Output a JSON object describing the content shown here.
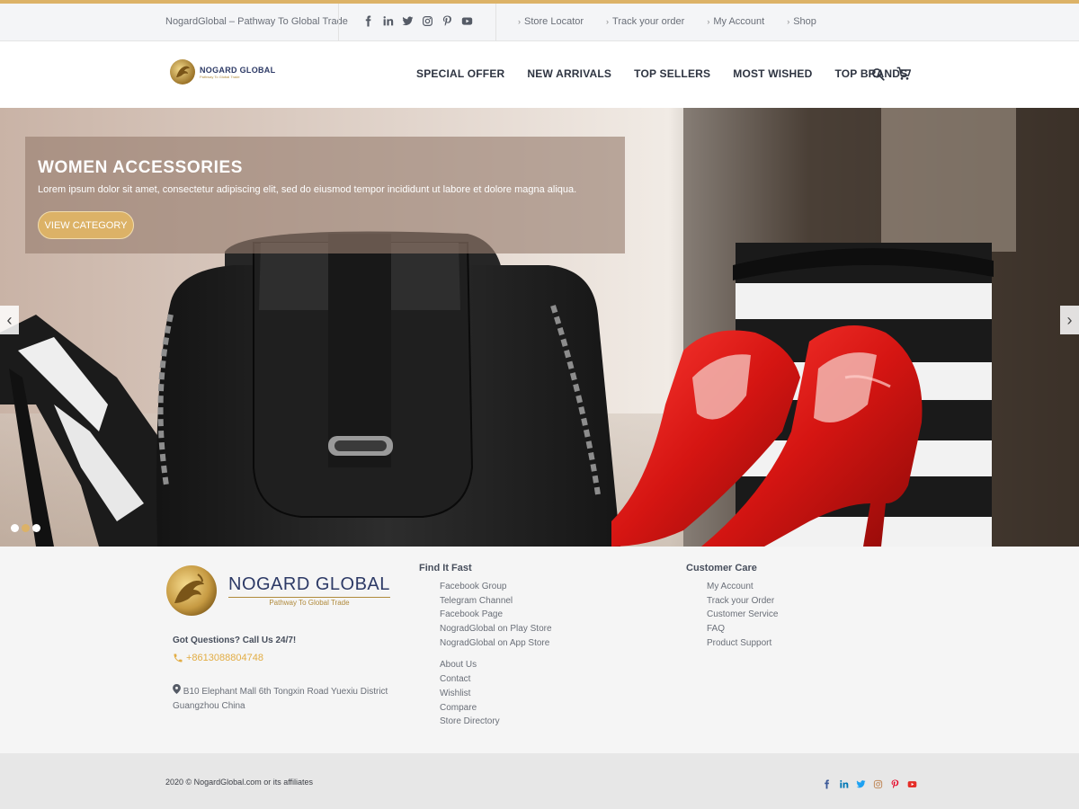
{
  "topbar": {
    "tagline": "NogardGlobal – Pathway To Global Trade",
    "links": [
      "Store Locator",
      "Track your order",
      "My Account",
      "Shop"
    ],
    "social_icons": [
      "facebook-icon",
      "linkedin-icon",
      "twitter-icon",
      "instagram-icon",
      "pinterest-icon",
      "youtube-icon"
    ]
  },
  "header": {
    "logo_text": "NOGARD GLOBAL",
    "logo_sub": "Pathway To Global Trade",
    "nav": [
      "SPECIAL OFFER",
      "NEW ARRIVALS",
      "TOP SELLERS",
      "MOST WISHED",
      "TOP BRANDS"
    ]
  },
  "hero": {
    "title": "WOMEN ACCESSORIES",
    "text": "Lorem ipsum dolor sit amet, consectetur adipiscing elit, sed do eiusmod tempor incididunt ut labore et dolore magna aliqua.",
    "button": "VIEW CATEGORY",
    "prev": "‹",
    "next": "›",
    "slide_count": 3,
    "active_slide": 2
  },
  "footer": {
    "logo_text": "NOGARD GLOBAL",
    "logo_sub": "Pathway To Global Trade",
    "questions": "Got Questions? Call Us 24/7!",
    "phone": "+8613088804748",
    "address": "B10 Elephant Mall 6th Tongxin Road Yuexiu District Guangzhou China",
    "find_title": "Find It Fast",
    "find_links": [
      "Facebook Group",
      "Telegram Channel",
      "Facebook Page",
      "NogradGlobal on Play Store",
      "NogradGlobal on App Store"
    ],
    "find_links_2": [
      "About Us",
      "Contact",
      "Wishlist",
      "Compare",
      "Store Directory"
    ],
    "care_title": "Customer Care",
    "care_links": [
      "My Account",
      "Track your Order",
      "Customer Service",
      "FAQ",
      "Product Support"
    ]
  },
  "bottom": {
    "copyright": "2020 © NogardGlobal.com or its affiliates"
  },
  "colors": {
    "accent": "#dcb267",
    "brand_navy": "#2d3a66",
    "facebook": "#3b5998",
    "linkedin": "#0077b5",
    "twitter": "#1da1f2",
    "instagram": "#c08a5c",
    "pinterest": "#e60023",
    "youtube": "#e52d27"
  }
}
